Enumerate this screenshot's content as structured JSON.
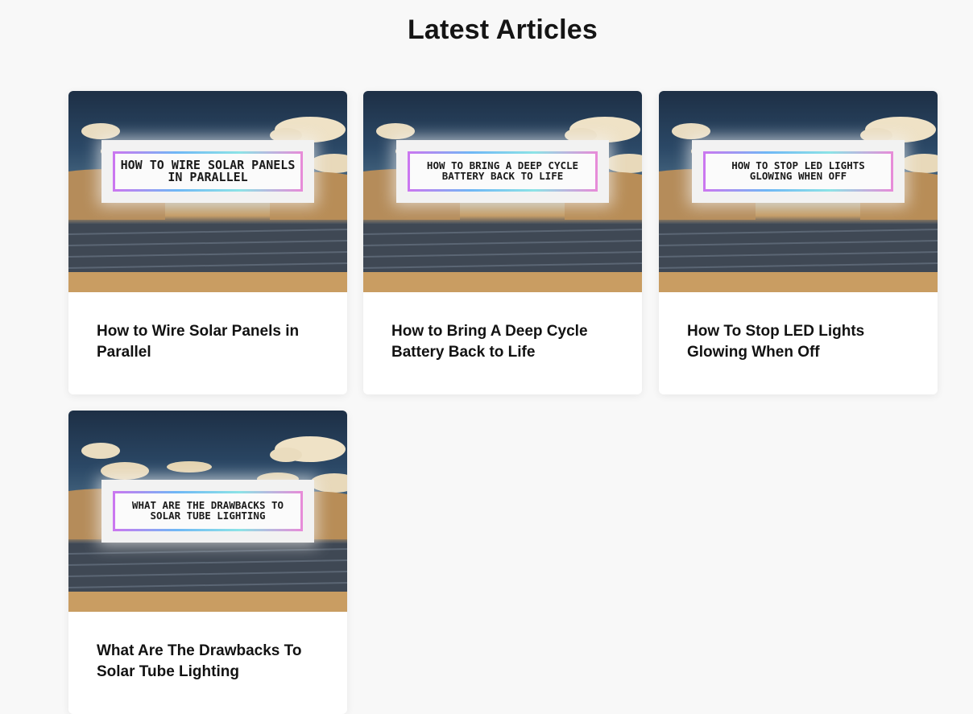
{
  "section": {
    "title": "Latest Articles"
  },
  "articles": [
    {
      "title": "How to Wire Solar Panels in Parallel",
      "thumb_text": "HOW TO WIRE SOLAR PANELS IN PARALLEL",
      "image_icon": "solar-field-image"
    },
    {
      "title": "How to Bring A Deep Cycle Battery Back to Life",
      "thumb_text": "HOW TO BRING A DEEP CYCLE BATTERY BACK TO LIFE",
      "image_icon": "solar-field-image"
    },
    {
      "title": "How To Stop LED Lights Glowing When Off",
      "thumb_text": "HOW TO STOP LED LIGHTS GLOWING WHEN OFF",
      "image_icon": "solar-field-image"
    },
    {
      "title": "What Are The Drawbacks To Solar Tube Lighting",
      "thumb_text": "WHAT ARE THE DRAWBACKS TO SOLAR TUBE LIGHTING",
      "image_icon": "solar-field-image"
    }
  ],
  "colors": {
    "page_background": "#f8f8f8",
    "card_background": "#ffffff",
    "title_text": "#121212"
  }
}
